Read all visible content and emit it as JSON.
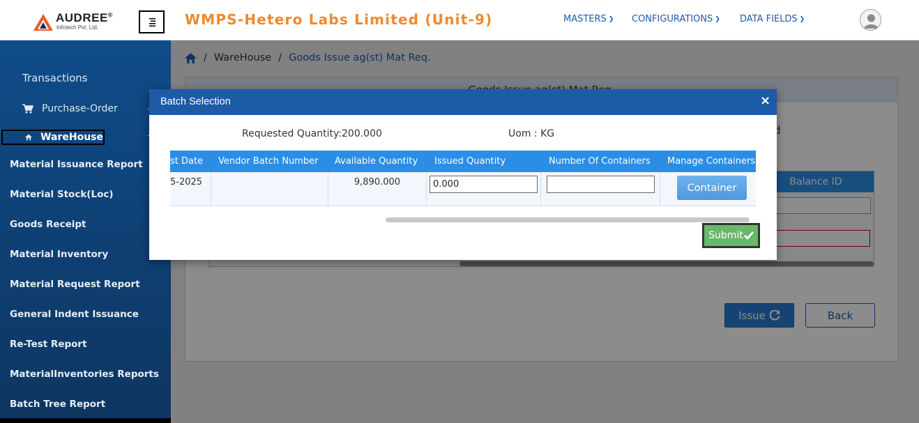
{
  "header": {
    "logo_text": "AUDREE",
    "logo_mark": "®",
    "logo_sub": "Infotech Pvt. Ltd.",
    "app_title": "WMPS-Hetero Labs Limited (Unit-9)",
    "nav": [
      {
        "label": "MASTERS"
      },
      {
        "label": "CONFIGURATIONS"
      },
      {
        "label": "DATA FIELDS"
      }
    ],
    "brand_color": "#f0892b",
    "accent_color": "#1d5ba6"
  },
  "sidebar": {
    "section_title": "Transactions",
    "purchase_order": "Purchase-Order",
    "warehouse": "WareHouse",
    "items": [
      {
        "label": "Material Issuance Report"
      },
      {
        "label": "Material Stock(Loc)"
      },
      {
        "label": "Goods Receipt"
      },
      {
        "label": "Material Inventory"
      },
      {
        "label": "Material Request Report"
      },
      {
        "label": "General Indent Issuance"
      },
      {
        "label": "Re-Test Report"
      },
      {
        "label": "MaterialInventories Reports"
      },
      {
        "label": "Batch Tree Report"
      }
    ]
  },
  "breadcrumb": {
    "parent": "WareHouse",
    "separator": "/",
    "current": "Goods Issue ag(st) Mat Req."
  },
  "background": {
    "panel_title": "Goods Issue ag(st) Mat Req.",
    "trailing_text": "d",
    "balance_header": "Balance ID",
    "issue_label": "Issue",
    "back_label": "Back"
  },
  "modal": {
    "title": "Batch Selection",
    "close_glyph": "×",
    "requested_quantity": "Requested Quantity:200.000",
    "uom": "Uom : KG",
    "columns": [
      "st Date",
      "Vendor Batch Number",
      "Available Quantity",
      "Issued Quantity",
      "Number Of Containers",
      "Manage Containers"
    ],
    "row": {
      "date": "5-2025",
      "vendor_batch_number": "",
      "available_quantity": "9,890.000",
      "issued_quantity": "0.000",
      "number_of_containers": ""
    },
    "container_label": "Container",
    "submit_label": "Submit"
  }
}
